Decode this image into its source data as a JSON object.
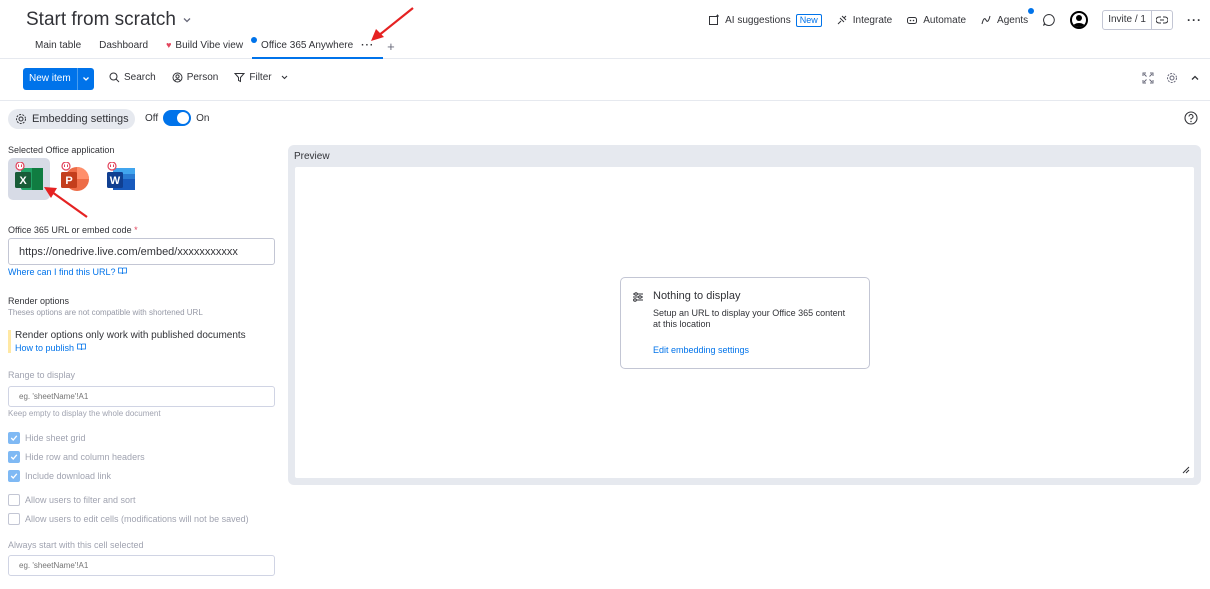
{
  "header": {
    "board_title": "Start from scratch",
    "tabs": [
      {
        "label": "Main table"
      },
      {
        "label": "Dashboard"
      },
      {
        "label": "Build Vibe view"
      },
      {
        "label": "Office 365 Anywhere"
      }
    ],
    "tab_more": "···",
    "tab_add": "+",
    "ai_suggestions": "AI suggestions",
    "new_badge": "New",
    "integrate": "Integrate",
    "automate": "Automate",
    "agents": "Agents",
    "invite": "Invite / 1",
    "more": "···"
  },
  "toolbar": {
    "new_item": "New item",
    "search": "Search",
    "person": "Person",
    "filter": "Filter"
  },
  "settings": {
    "embedding_settings": "Embedding settings",
    "toggle_off": "Off",
    "toggle_on": "On"
  },
  "left": {
    "selected_app_title": "Selected Office application",
    "apps": [
      "excel-icon",
      "powerpoint-icon",
      "word-icon"
    ],
    "url_label": "Office 365 URL or embed code",
    "required_mark": "*",
    "url_value": "https://onedrive.live.com/embed/xxxxxxxxxxx",
    "where_link": "Where can I find this URL?",
    "render_title": "Render options",
    "render_sub": "Theses options are not compatible with shortened URL",
    "notice_text": "Render options only work with published documents",
    "notice_link": "How to publish",
    "range_label": "Range to display",
    "range_placeholder": "eg. 'sheetName'!A1",
    "range_hint": "Keep empty to display the whole document",
    "checkboxes": [
      {
        "label": "Hide sheet grid",
        "checked": true
      },
      {
        "label": "Hide row and column headers",
        "checked": true
      },
      {
        "label": "Include download link",
        "checked": true
      },
      {
        "label": "Allow users to filter and sort",
        "checked": false
      },
      {
        "label": "Allow users to edit cells (modifications will not be saved)",
        "checked": false
      }
    ],
    "start_label": "Always start with this cell selected",
    "start_placeholder": "eg. 'sheetName'!A1"
  },
  "preview": {
    "title": "Preview",
    "empty_title": "Nothing to display",
    "empty_desc": "Setup an URL to display your Office 365 content at this location",
    "empty_link": "Edit embedding settings"
  },
  "colors": {
    "accent": "#0073ea",
    "annotation_arrow": "#e52222"
  }
}
